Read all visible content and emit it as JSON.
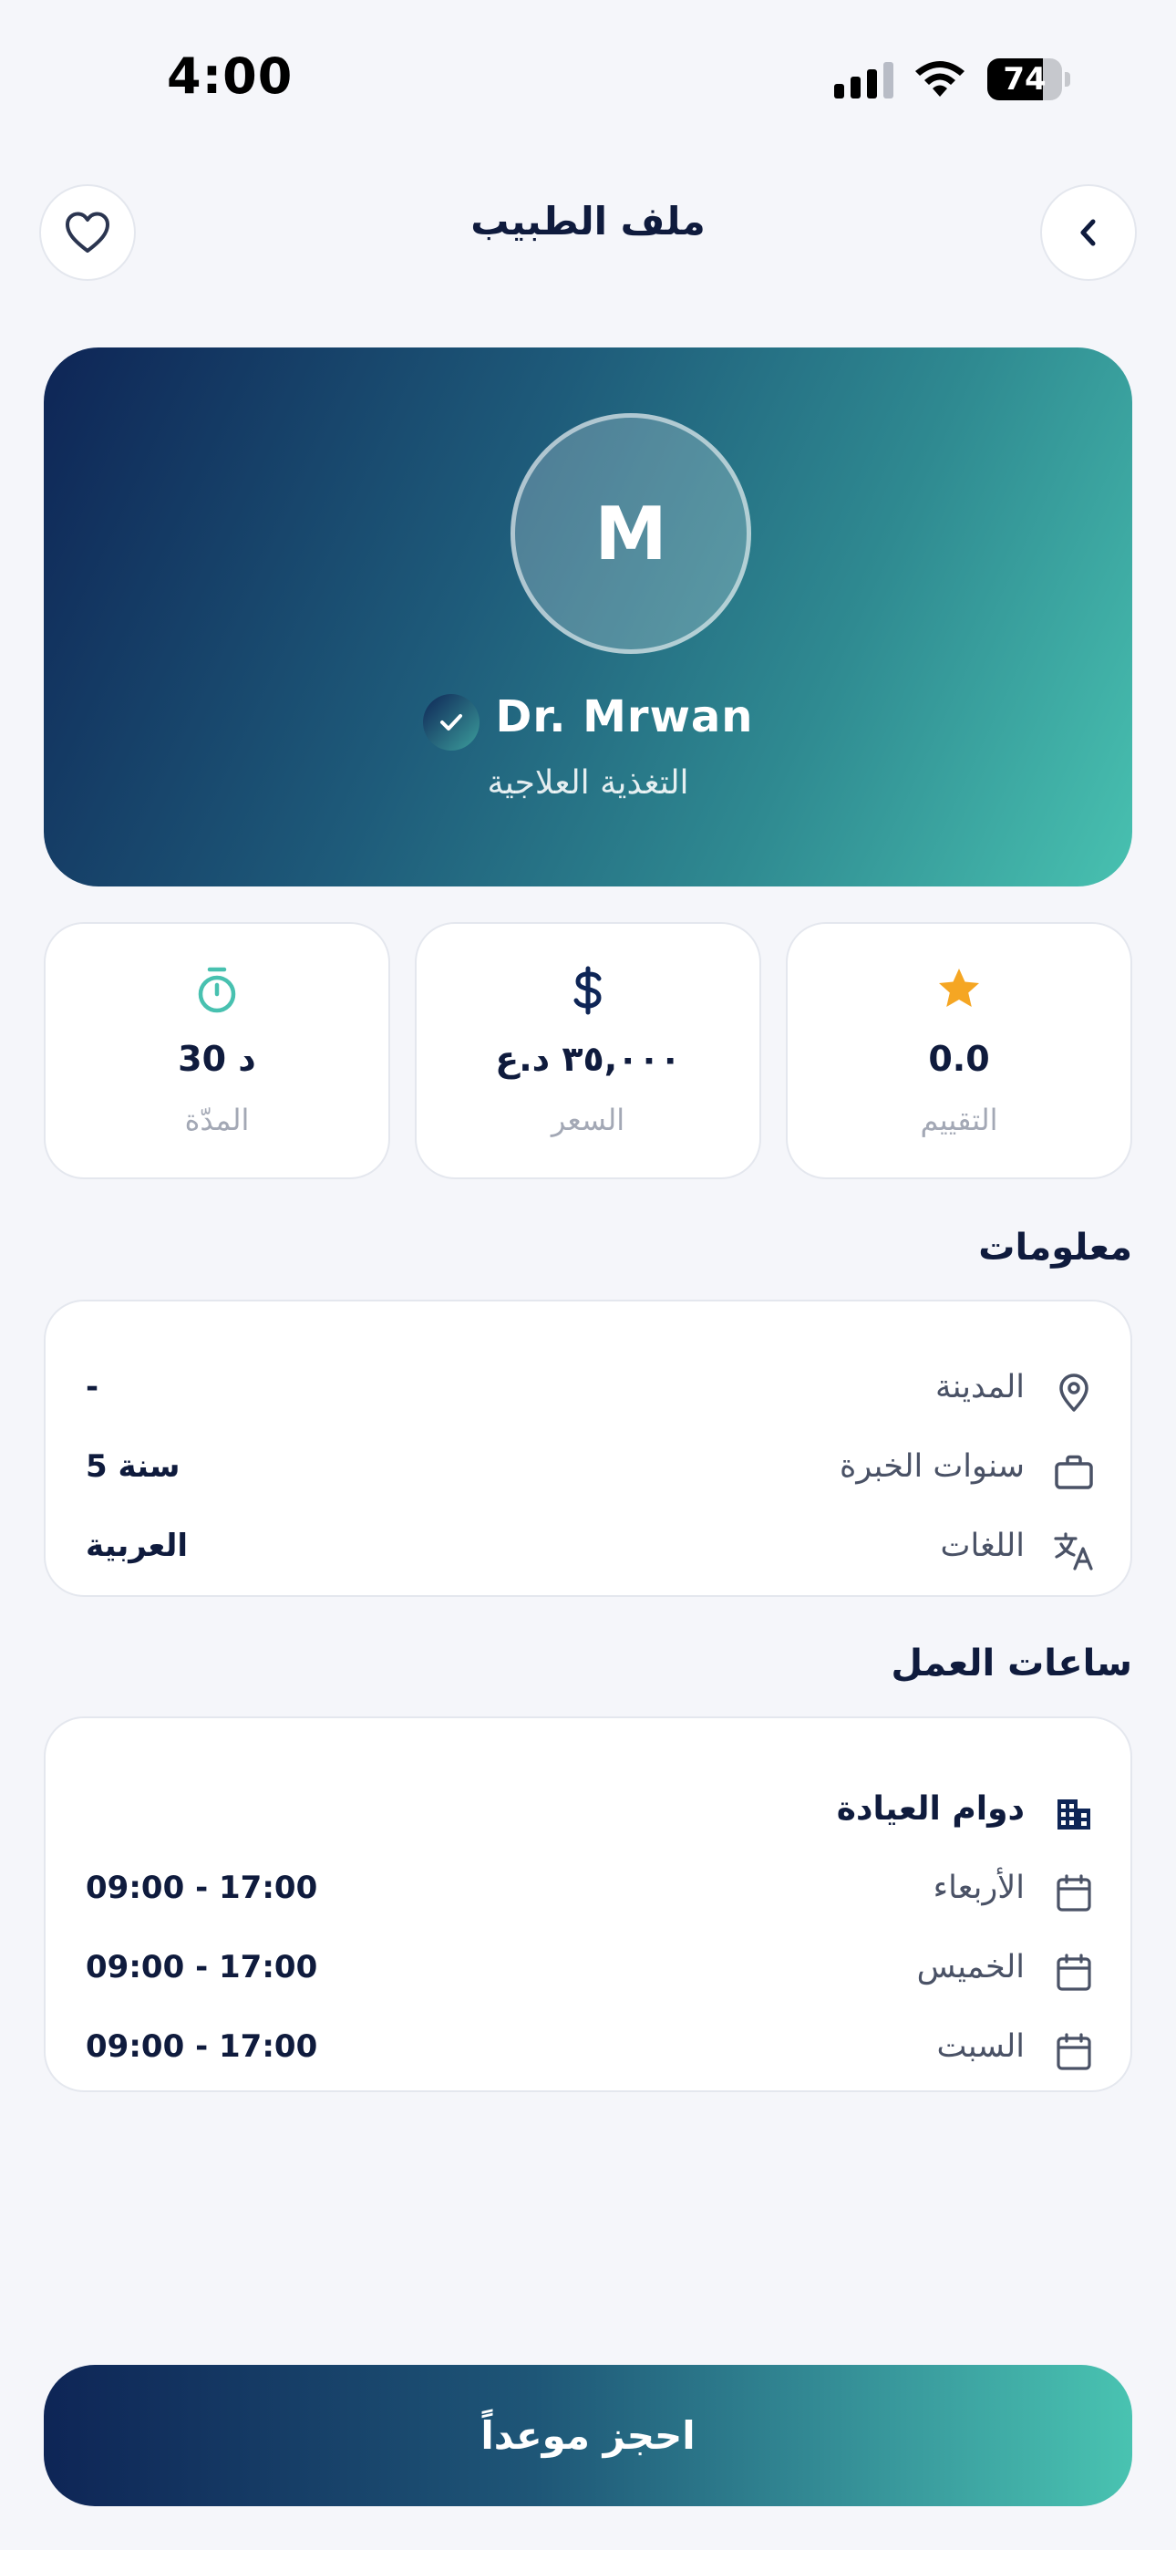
{
  "status_bar": {
    "time": "4:00",
    "battery_level": "74",
    "battery_fraction": 0.74
  },
  "header": {
    "title": "ملف الطبيب",
    "back_icon": "chevron-left-icon",
    "favorite_icon": "heart-icon"
  },
  "doctor": {
    "avatar_initial": "M",
    "name": "Dr. Mrwan",
    "specialty": "التغذية العلاجية",
    "verified_icon": "check-badge-icon"
  },
  "stats": {
    "rating": {
      "value": "0.0",
      "label": "التقييم",
      "icon": "star-icon"
    },
    "price": {
      "value": "٣٥,٠٠٠ د.ع",
      "label": "السعر",
      "icon": "dollar-icon"
    },
    "duration": {
      "value": "30 د",
      "label": "المدّة",
      "icon": "stopwatch-icon"
    }
  },
  "info": {
    "title": "معلومات",
    "rows": [
      {
        "label": "المدينة",
        "value": "-",
        "icon": "location-pin-icon"
      },
      {
        "label": "سنوات الخبرة",
        "value": "5 سنة",
        "icon": "briefcase-icon"
      },
      {
        "label": "اللغات",
        "value": "العربية",
        "icon": "translate-icon"
      }
    ]
  },
  "hours": {
    "title": "ساعات العمل",
    "clinic_label": "دوام العيادة",
    "clinic_icon": "building-icon",
    "days": [
      {
        "day": "الأربعاء",
        "time": "09:00 - 17:00",
        "icon": "calendar-icon"
      },
      {
        "day": "الخميس",
        "time": "09:00 - 17:00",
        "icon": "calendar-icon"
      },
      {
        "day": "السبت",
        "time": "09:00 - 17:00",
        "icon": "calendar-icon"
      }
    ]
  },
  "book_button": {
    "label": "احجز موعداً"
  },
  "colors": {
    "primary_dark": "#0e2556",
    "accent_teal": "#48c1b0",
    "star": "#f5a623",
    "text_dark": "#0f1b3d",
    "text_muted": "#a3a8b5"
  }
}
